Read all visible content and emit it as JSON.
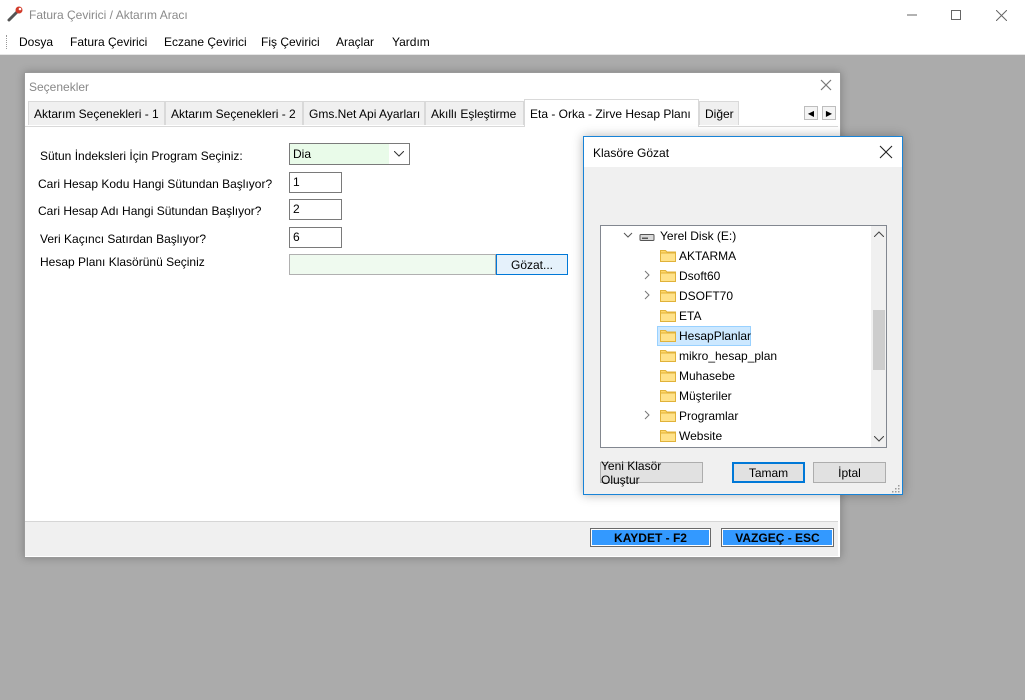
{
  "app": {
    "title": "Fatura Çevirici / Aktarım Aracı",
    "menu": [
      "Dosya",
      "Fatura Çevirici",
      "Eczane Çevirici",
      "Fiş Çevirici",
      "Araçlar",
      "Yardım"
    ]
  },
  "options": {
    "title": "Seçenekler",
    "tabs": [
      "Aktarım Seçenekleri - 1",
      "Aktarım Seçenekleri - 2",
      "Gms.Net Api Ayarları",
      "Akıllı Eşleştirme",
      "Eta - Orka - Zirve Hesap Planı",
      "Diğer"
    ],
    "active_tab": "Eta - Orka - Zirve Hesap Planı",
    "form": {
      "program_label": "Sütun İndeksleri İçin Program Seçiniz:",
      "program_value": "Dia",
      "code_col_label": "Cari Hesap Kodu Hangi Sütundan Başlıyor?",
      "code_col_value": "1",
      "name_col_label": "Cari Hesap Adı Hangi Sütundan Başlıyor?",
      "name_col_value": "2",
      "start_row_label": "Veri Kaçıncı Satırdan Başlıyor?",
      "start_row_value": "6",
      "folder_label": "Hesap Planı Klasörünü Seçiniz",
      "folder_value": "",
      "browse_label": "Gözat..."
    },
    "save_label": "KAYDET - F2",
    "cancel_label": "VAZGEÇ - ESC"
  },
  "browse_dialog": {
    "title": "Klasöre Gözat",
    "tree": {
      "root": "Yerel Disk (E:)",
      "folders": [
        {
          "name": "AKTARMA",
          "expandable": false,
          "selected": false
        },
        {
          "name": "Dsoft60",
          "expandable": true,
          "selected": false
        },
        {
          "name": "DSOFT70",
          "expandable": true,
          "selected": false
        },
        {
          "name": "ETA",
          "expandable": false,
          "selected": false
        },
        {
          "name": "HesapPlanlar",
          "expandable": false,
          "selected": true
        },
        {
          "name": "mikro_hesap_plan",
          "expandable": false,
          "selected": false
        },
        {
          "name": "Muhasebe",
          "expandable": false,
          "selected": false
        },
        {
          "name": "Müşteriler",
          "expandable": false,
          "selected": false
        },
        {
          "name": "Programlar",
          "expandable": true,
          "selected": false
        },
        {
          "name": "Website",
          "expandable": false,
          "selected": false
        }
      ]
    },
    "new_folder_label": "Yeni Klasör Oluştur",
    "ok_label": "Tamam",
    "cancel_label": "İptal"
  },
  "colors": {
    "action_button": "#3399ff",
    "selection": "#cce8ff",
    "input_tint": "#e9fbe9"
  }
}
